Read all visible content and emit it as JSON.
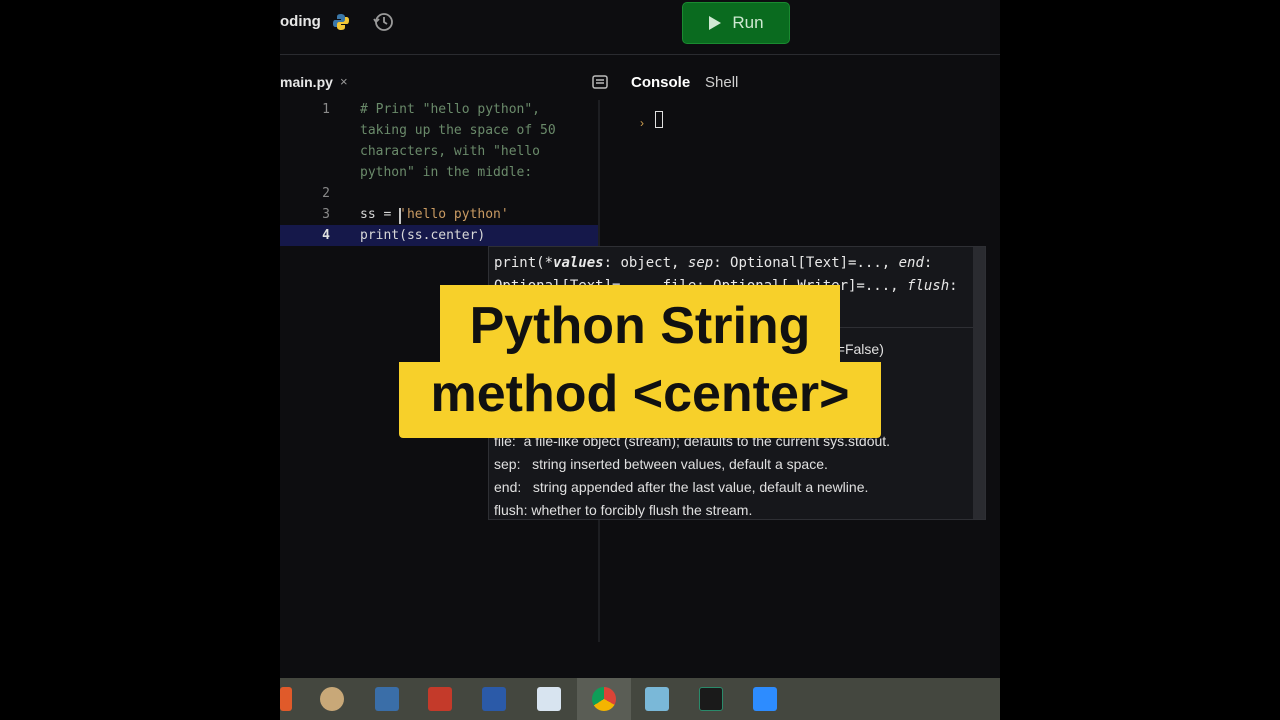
{
  "topbar": {
    "repl_name": "oding",
    "run_label": "Run"
  },
  "editor": {
    "file_tab": "main.py",
    "tab_close": "×",
    "lines": [
      {
        "num": "1",
        "text": "# Print \"hello python\","
      },
      {
        "num": "",
        "text": "taking up the space of 50"
      },
      {
        "num": "",
        "text": "characters, with \"hello"
      },
      {
        "num": "",
        "text": "python\" in the middle:"
      },
      {
        "num": "2",
        "text": ""
      },
      {
        "num": "3",
        "text_a": "ss = ",
        "text_b": "'hello python'"
      },
      {
        "num": "4",
        "text": "print(ss.center)"
      }
    ]
  },
  "console": {
    "tab_console": "Console",
    "tab_shell": "Shell",
    "prompt": "›"
  },
  "signature": {
    "line1_a": "print(*",
    "line1_param": "values",
    "line1_b": ": object, ",
    "line1_sep": "sep",
    "line1_c": ": Optional[Text]=..., ",
    "line1_end": "end",
    "line1_d": ":",
    "line2_a": "Optional[Text]=..., file: Optional[_Writer]=..., ",
    "line2_flush": "flush",
    "line2_b": ":",
    "line3": "h=False)",
    "doc": [
      "file:  a file-like object (stream); defaults to the current sys.stdout.",
      "sep:   string inserted between values, default a space.",
      "end:   string appended after the last value, default a newline.",
      "flush: whether to forcibly flush the stream."
    ]
  },
  "overlay_title": {
    "line1": "Python String",
    "line2": "method <center>"
  },
  "taskbar": {
    "icons": [
      "paint-icon",
      "calculator-icon",
      "powerpoint-icon",
      "word-icon",
      "notepad-icon",
      "chrome-icon",
      "files-icon",
      "editor-icon",
      "zoom-icon"
    ]
  },
  "colors": {
    "run_button": "#0a6b1f",
    "title_bg": "#f7d02a",
    "active_line": "#15184a",
    "string": "#c99a62",
    "comment": "#6a8a6a"
  }
}
